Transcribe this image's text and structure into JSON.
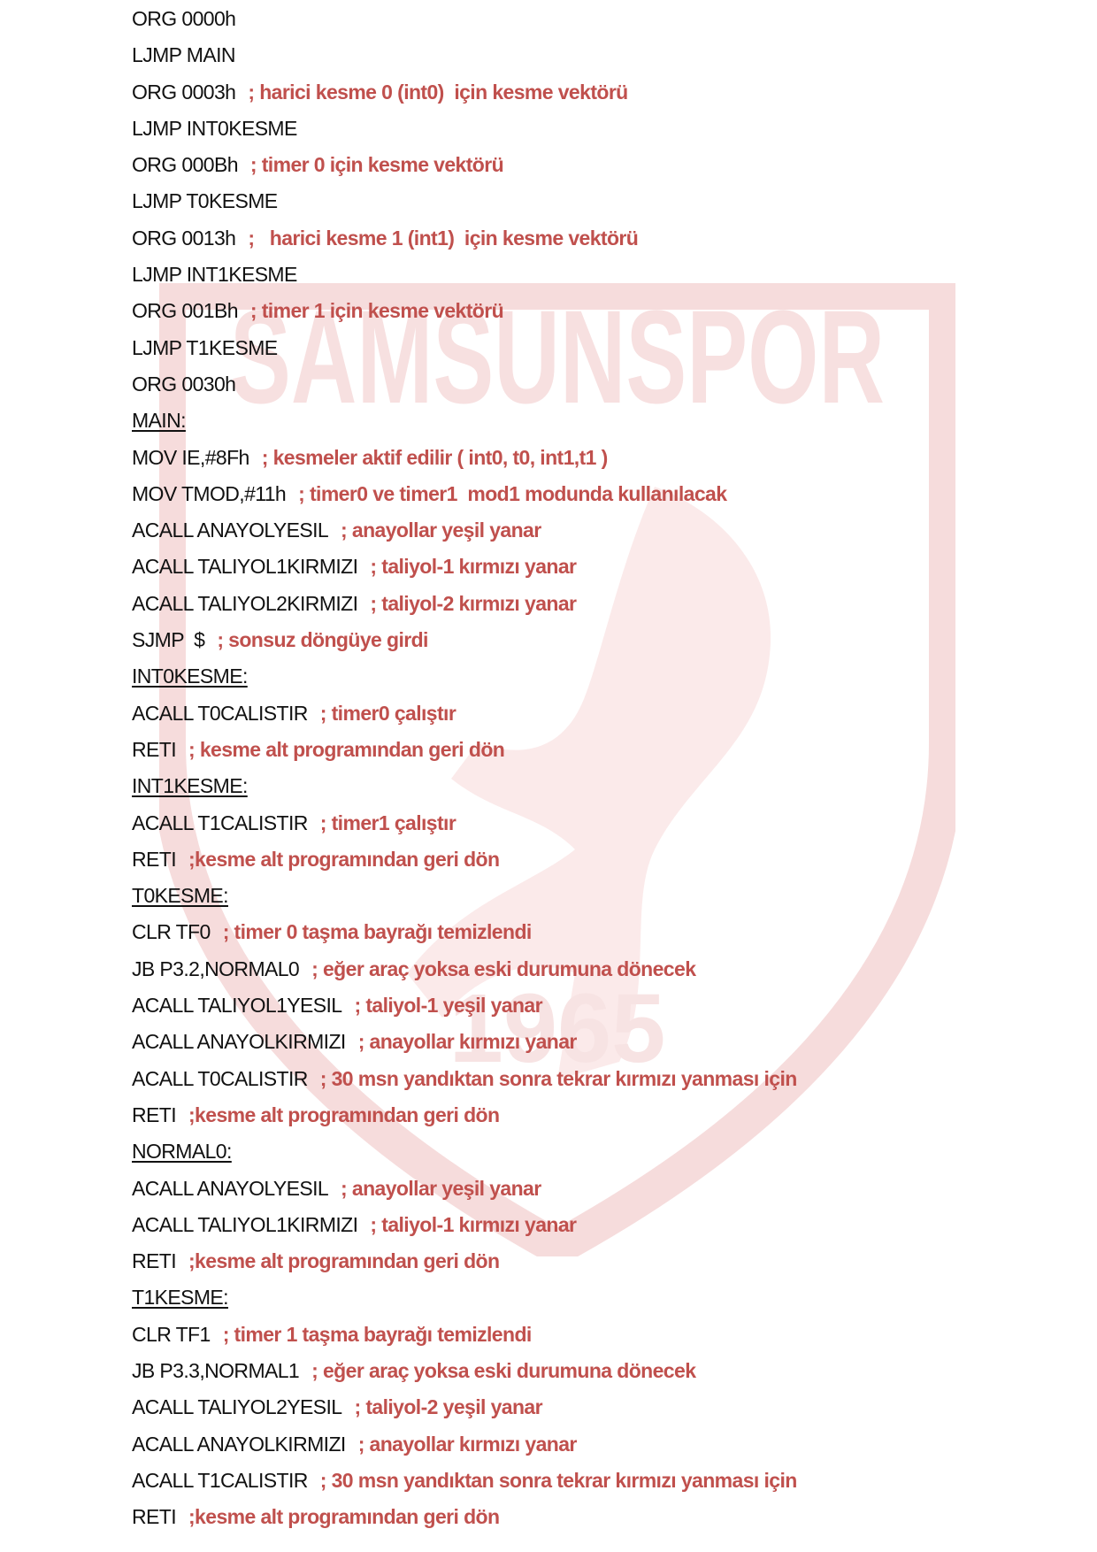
{
  "watermark": {
    "text": "SAMSUNSPOR",
    "year": "1965",
    "color": "#f3d3d3"
  },
  "colors": {
    "code": "#111111",
    "comment": "#c0504d"
  },
  "lines": [
    {
      "code": "ORG 0000h"
    },
    {
      "code": "LJMP MAIN"
    },
    {
      "code": "ORG 0003h",
      "comment": "; harici kesme 0 (int0)  için kesme vektörü"
    },
    {
      "code": "LJMP INT0KESME"
    },
    {
      "code": "ORG 000Bh",
      "comment": "; timer 0 için kesme vektörü"
    },
    {
      "code": "LJMP T0KESME"
    },
    {
      "code": "ORG 0013h",
      "comment": ";   harici kesme 1 (int1)  için kesme vektörü"
    },
    {
      "code": "LJMP INT1KESME"
    },
    {
      "code": "ORG 001Bh",
      "comment": "; timer 1 için kesme vektörü"
    },
    {
      "code": "LJMP T1KESME"
    },
    {
      "code": "ORG 0030h"
    },
    {
      "label": "MAIN:"
    },
    {
      "code": "MOV IE,#8Fh",
      "comment": "; kesmeler aktif edilir ( int0, t0, int1,t1 )"
    },
    {
      "code": "MOV TMOD,#11h",
      "comment": "; timer0 ve timer1  mod1 modunda kullanılacak"
    },
    {
      "code": "ACALL ANAYOLYESIL",
      "comment": "; anayollar yeşil yanar"
    },
    {
      "code": "ACALL TALIYOL1KIRMIZI",
      "comment": "; taliyol-1 kırmızı yanar"
    },
    {
      "code": "ACALL TALIYOL2KIRMIZI",
      "comment": "; taliyol-2 kırmızı yanar"
    },
    {
      "code": "SJMP  $",
      "comment": "; sonsuz döngüye girdi"
    },
    {
      "label": "INT0KESME:"
    },
    {
      "code": "ACALL T0CALISTIR",
      "comment": "; timer0 çalıştır"
    },
    {
      "code": "RETI",
      "comment": "; kesme alt programından geri dön"
    },
    {
      "label": "INT1KESME:"
    },
    {
      "code": "ACALL T1CALISTIR",
      "comment": "; timer1 çalıştır"
    },
    {
      "code": "RETI",
      "comment": ";kesme alt programından geri dön"
    },
    {
      "label": "T0KESME:"
    },
    {
      "code": "CLR TF0",
      "comment": "; timer 0 taşma bayrağı temizlendi"
    },
    {
      "code": "JB P3.2,NORMAL0",
      "comment": "; eğer araç yoksa eski durumuna dönecek"
    },
    {
      "code": "ACALL TALIYOL1YESIL",
      "comment": "; taliyol-1 yeşil yanar"
    },
    {
      "code": "ACALL ANAYOLKIRMIZI",
      "comment": "; anayollar kırmızı yanar"
    },
    {
      "code": "ACALL T0CALISTIR",
      "comment": "; 30 msn yandıktan sonra tekrar kırmızı yanması için"
    },
    {
      "code": "RETI",
      "comment": ";kesme alt programından geri dön"
    },
    {
      "label": "NORMAL0:"
    },
    {
      "code": "ACALL ANAYOLYESIL",
      "comment": "; anayollar yeşil yanar"
    },
    {
      "code": "ACALL TALIYOL1KIRMIZI",
      "comment": "; taliyol-1 kırmızı yanar"
    },
    {
      "code": "RETI",
      "comment": ";kesme alt programından geri dön"
    },
    {
      "label": "T1KESME:"
    },
    {
      "code": "CLR TF1",
      "comment": "; timer 1 taşma bayrağı temizlendi"
    },
    {
      "code": "JB P3.3,NORMAL1",
      "comment": "; eğer araç yoksa eski durumuna dönecek"
    },
    {
      "code": "ACALL TALIYOL2YESIL",
      "comment": "; taliyol-2 yeşil yanar"
    },
    {
      "code": "ACALL ANAYOLKIRMIZI",
      "comment": "; anayollar kırmızı yanar"
    },
    {
      "code": "ACALL T1CALISTIR",
      "comment": "; 30 msn yandıktan sonra tekrar kırmızı yanması için"
    },
    {
      "code": "RETI",
      "comment": ";kesme alt programından geri dön"
    }
  ]
}
